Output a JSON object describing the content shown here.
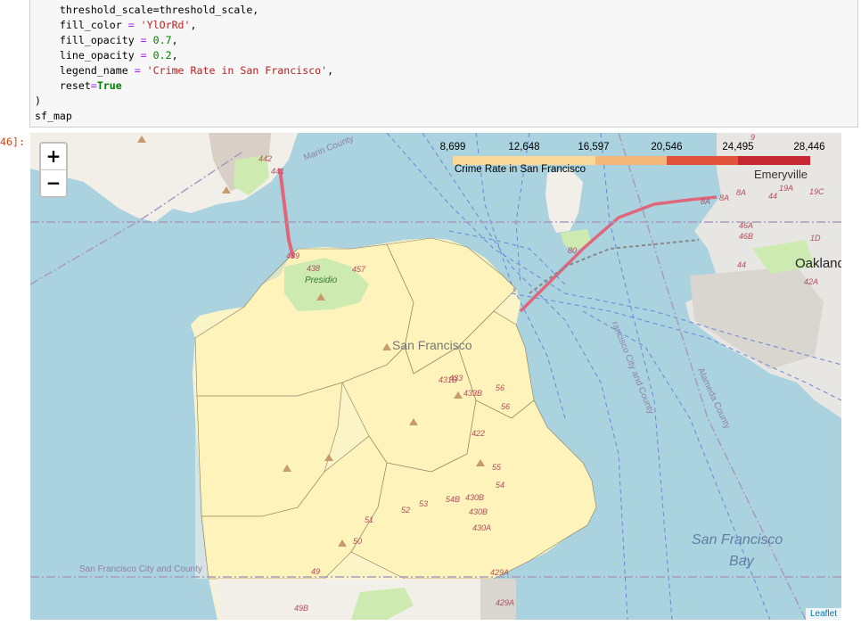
{
  "code": {
    "line1": "    threshold_scale=threshold_scale,",
    "line2_key": "    fill_color ",
    "line2_val": "'YlOrRd'",
    "line3_key": "    fill_opacity ",
    "line3_val": "0.7",
    "line4_key": "    line_opacity ",
    "line4_val": "0.2",
    "line5_key": "    legend_name ",
    "line5_val": "'Crime Rate in San Francisco'",
    "line6_key": "    reset",
    "line6_val": "True",
    "line7": ")",
    "line8": "sf_map",
    "eq": "=",
    "comma": ","
  },
  "prompt": "46]:",
  "zoom": {
    "in_label": "+",
    "out_label": "−"
  },
  "legend": {
    "caption": "Crime Rate in San Francisco",
    "ticks": [
      "8,699",
      "12,648",
      "16,597",
      "20,546",
      "24,495",
      "28,446"
    ],
    "colors": [
      "#f8d998",
      "#f3b877",
      "#ee9a5a",
      "#e0533a",
      "#c52831"
    ]
  },
  "map_labels": {
    "san_francisco": "San Francisco",
    "emeryville": "Emeryville",
    "oakland": "Oakland",
    "presidio": "Presidio",
    "sf_bay_line1": "San Francisco",
    "sf_bay_line2": "Bay",
    "marin_county": "Marin County",
    "sf_city_county": "San Francisco City and County",
    "sf_city_county_vertical": "rancisco City and County",
    "alameda_county": "Alameda County",
    "routes": [
      "442",
      "441",
      "439",
      "438",
      "457",
      "80",
      "8A",
      "8A",
      "8A",
      "19A",
      "19C",
      "46A",
      "46B",
      "44",
      "44",
      "1D",
      "42A",
      "433",
      "433B",
      "56",
      "56",
      "55",
      "54",
      "54B",
      "430B",
      "430B",
      "430A",
      "53",
      "52",
      "51",
      "50",
      "49",
      "49B",
      "429A",
      "429A",
      "422",
      "431B",
      "9"
    ]
  },
  "attribution": "Leaflet"
}
